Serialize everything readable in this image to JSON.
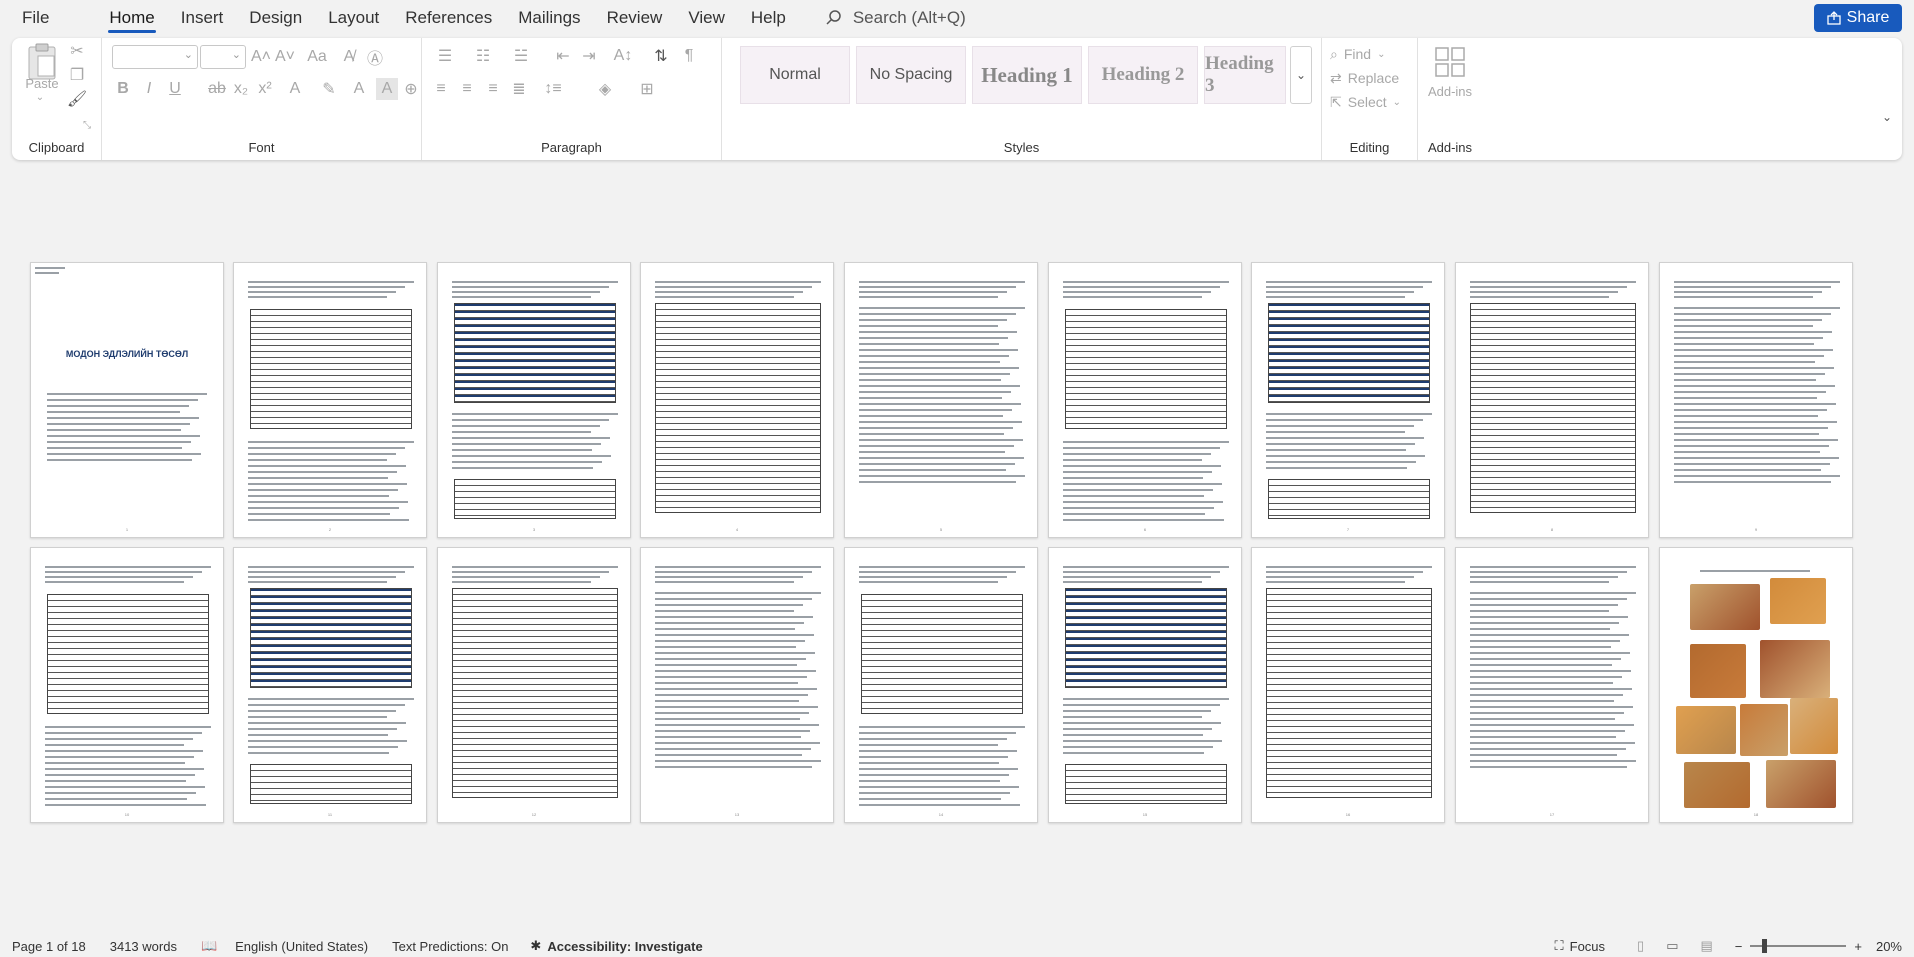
{
  "menu": {
    "tabs": [
      "File",
      "Home",
      "Insert",
      "Design",
      "Layout",
      "References",
      "Mailings",
      "Review",
      "View",
      "Help"
    ],
    "active_tab": "Home",
    "search_placeholder": "Search (Alt+Q)",
    "share_label": "Share"
  },
  "ribbon": {
    "clipboard": {
      "label": "Clipboard",
      "paste_label": "Paste"
    },
    "font": {
      "label": "Font",
      "font_name": "",
      "font_size": ""
    },
    "paragraph": {
      "label": "Paragraph"
    },
    "styles": {
      "label": "Styles",
      "items": [
        "Normal",
        "No Spacing",
        "Heading 1",
        "Heading 2",
        "Heading 3"
      ]
    },
    "editing": {
      "label": "Editing",
      "find": "Find",
      "replace": "Replace",
      "select": "Select"
    },
    "addins": {
      "label": "Add-ins",
      "button": "Add-ins"
    }
  },
  "document": {
    "cover_title": "МОДОН ЭДЛЭЛИЙН ТӨСӨЛ",
    "page_numbers": [
      "1",
      "2",
      "3",
      "4",
      "5",
      "6",
      "7",
      "8",
      "9",
      "10",
      "11",
      "12",
      "13",
      "14",
      "15",
      "16",
      "17",
      "18"
    ]
  },
  "status": {
    "page": "Page 1 of 18",
    "words": "3413 words",
    "language": "English (United States)",
    "predictions": "Text Predictions: On",
    "accessibility": "Accessibility: Investigate",
    "focus": "Focus",
    "zoom": "20%"
  },
  "colors": {
    "accent": "#185abd",
    "doc_title": "#1f3c6e"
  },
  "icons": [
    "search-icon",
    "share-icon",
    "paste-icon",
    "cut-icon",
    "copy-icon",
    "format-painter-icon",
    "bold-icon",
    "italic-icon",
    "underline-icon",
    "find-icon",
    "replace-icon",
    "select-icon",
    "addins-icon",
    "proofing-icon",
    "accessibility-icon",
    "focus-icon",
    "zoom-slider"
  ]
}
